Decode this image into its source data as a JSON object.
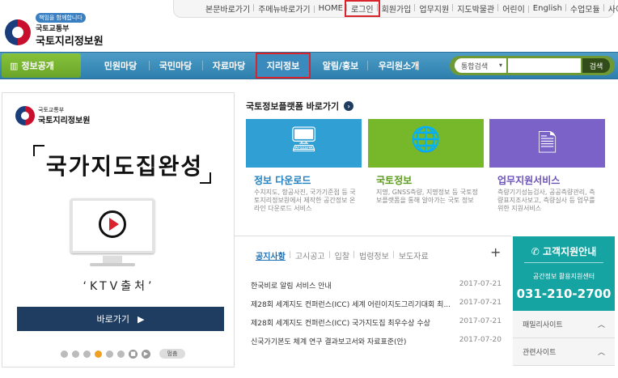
{
  "toplinks": [
    "본문바로가기",
    "주메뉴바로가기",
    "HOME",
    "로그인",
    "회원가입",
    "업무지원",
    "지도박물관",
    "어린이",
    "English",
    "수업모듈",
    "사이트맵"
  ],
  "logo": {
    "badge": "책임을 함께합니다",
    "org": "국토교통부",
    "name": "국토지리정보원"
  },
  "nav": {
    "info": "정보공개",
    "items": [
      "민원마당",
      "국민마당",
      "자료마당",
      "지리정보",
      "알림/홍보",
      "우리원소개"
    ],
    "search": {
      "select": "통합검색",
      "placeholder": "",
      "button": "검색"
    }
  },
  "banner": {
    "org": "국토교통부",
    "name": "국토지리정보원",
    "title": "국가지도집완성",
    "source": "‘KTV출처’",
    "go_label": "바로가기",
    "pause": "멈춤",
    "colors": {
      "go_bg": "#1f3c61"
    }
  },
  "platform": {
    "title": "국토정보플랫폼 바로가기",
    "cards": [
      {
        "title": "정보 다운로드",
        "desc": "수치지도, 항공사진, 국가기준점 등 국토지리정보원에서 제작한 공간정보 온라인 다운로드 서비스",
        "icon": "monitor-icon",
        "color": "#2f9fd4",
        "title_color": "#1f7fbf"
      },
      {
        "title": "국토정보",
        "desc": "지명, GNSS측량, 지명정보 등 국토정보플랫폼을 통해 알아가는 국토 정보",
        "icon": "globe-icon",
        "color": "#76b82a",
        "title_color": "#5a9a1a"
      },
      {
        "title": "업무지원서비스",
        "desc": "측량기기성능검사, 공공측량관리, 측량표지조사보고, 측량실사 등 업무를 위한 지원서비스",
        "icon": "document-icon",
        "color": "#7a62c8",
        "title_color": "#6a52b8"
      }
    ]
  },
  "notices": {
    "tabs": [
      "공지사항",
      "고시공고",
      "입찰",
      "법령정보",
      "보도자료"
    ],
    "items": [
      {
        "title": "한국비로 알림 서비스 안내",
        "date": "2017-07-21"
      },
      {
        "title": "제28회 세계지도 컨퍼런스(ICC) 세계 어린이지도그리기대회 최...",
        "date": "2017-07-21"
      },
      {
        "title": "제28회 세계지도 컨퍼런스(ICC) 국가지도집 최우수상 수상",
        "date": "2017-07-21"
      },
      {
        "title": "신국가기본도 체계 연구 결과보고서와 자료표준(안)",
        "date": "2017-07-20"
      }
    ]
  },
  "customer": {
    "title": "고객지원안내",
    "sub": "공간정보 활용지원센터",
    "tel": "031-210-2700",
    "family": "패밀리사이트",
    "related": "관련사이트"
  }
}
